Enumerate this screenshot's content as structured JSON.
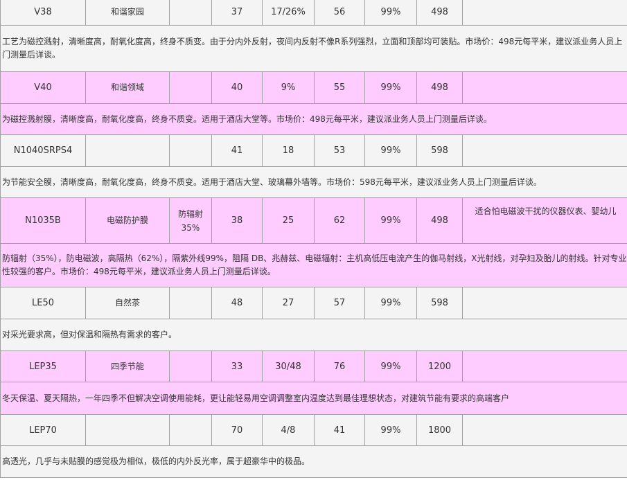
{
  "rows": [
    {
      "model": "V38",
      "name": "和谐家园",
      "note": "",
      "c1": "37",
      "c2": "17/26%",
      "c3": "56",
      "uv": "99%",
      "price": "498",
      "remark": "",
      "desc": "工艺为磁控溅射，清晰度高，耐氧化度高，终身不质变。由于分内外反射，夜间内反射不像R系列强烈，立面和顶部均可装贴。市场价：498元每平米，建议派业务人员上门测量后详谈。"
    },
    {
      "model": "V40",
      "name": "和谐领域",
      "note": "",
      "c1": "40",
      "c2": "9%",
      "c3": "55",
      "uv": "99%",
      "price": "498",
      "remark": "",
      "desc": "为磁控溅射膜，清晰度高，耐氧化度高，终身不质变。适用于酒店大堂等。市场价：498元每平米，建议派业务人员上门测量后详谈。"
    },
    {
      "model": "N1040SRPS4",
      "name": "",
      "note": "",
      "c1": "41",
      "c2": "18",
      "c3": "53",
      "uv": "99%",
      "price": "598",
      "remark": "",
      "desc": "为节能安全膜，清晰度高，耐氧化度高，终身不质变。适用于酒店大堂、玻璃幕外墙等。市场价：598元每平米，建议派业务人员上门测量后详谈。"
    },
    {
      "model": "N1035B",
      "name": "电磁防护膜",
      "note": "防辐射35%",
      "c1": "38",
      "c2": "25",
      "c3": "62",
      "uv": "99%",
      "price": "498",
      "remark": "适合怕电磁波干扰的仪器仪表、婴幼儿",
      "desc": "防辐射（35%），防电磁波，高隔热（62%），隔紫外线99%，阻隔 DB、兆赫兹、电磁辐射：主机高低压电流产生的伽马射线，X光射线，对孕妇及胎儿的射线。针对专业性较强的客户。市场价：498元每平米，建议派业务人员上门测量后详谈。"
    },
    {
      "model": "LE50",
      "name": "自然茶",
      "note": "",
      "c1": "48",
      "c2": "27",
      "c3": "57",
      "uv": "99%",
      "price": "598",
      "remark": "",
      "desc": "对采光要求高，但对保温和隔热有需求的客户。"
    },
    {
      "model": "LEP35",
      "name": "四季节能",
      "note": "",
      "c1": "33",
      "c2": "30/48",
      "c3": "76",
      "uv": "99%",
      "price": "1200",
      "remark": "",
      "desc": "冬天保温、夏天隔热，一年四季不但解决空调使用能耗，更让能轻易用空调调整室内温度达到最佳理想状态，对建筑节能有要求的高端客户"
    },
    {
      "model": "LEP70",
      "name": "",
      "note": "",
      "c1": "70",
      "c2": "4/8",
      "c3": "41",
      "uv": "99%",
      "price": "1800",
      "remark": "",
      "desc": "高透光，几乎与未贴膜的感觉极为相似，极低的内外反光率，属于超豪华中的极品。"
    }
  ]
}
